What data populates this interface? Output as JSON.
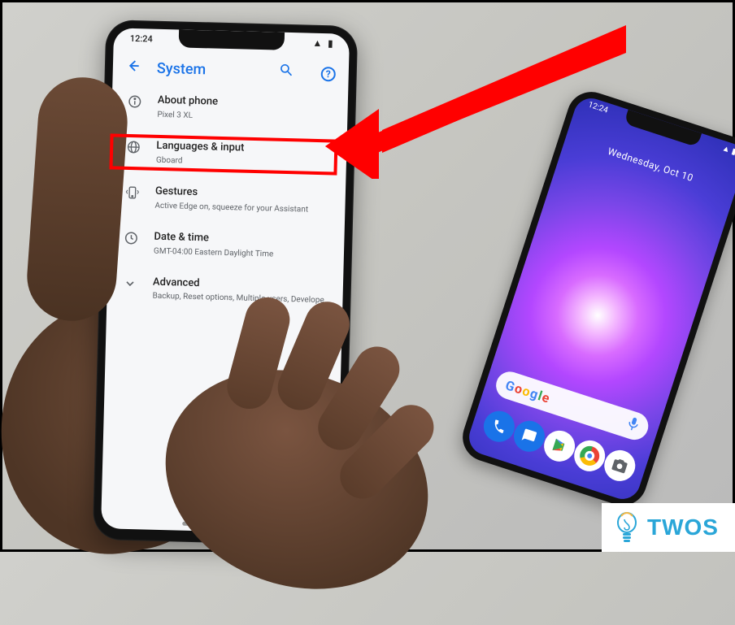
{
  "statusbar": {
    "time": "12:24"
  },
  "appbar": {
    "title": "System",
    "search_aria": "Search settings",
    "help_aria": "Help"
  },
  "items": {
    "about": {
      "label": "About phone",
      "secondary": "Pixel 3 XL"
    },
    "lang": {
      "label": "Languages & input",
      "secondary": "Gboard"
    },
    "gestures": {
      "label": "Gestures",
      "secondary": "Active Edge on, squeeze for your Assistant"
    },
    "datetime": {
      "label": "Date & time",
      "secondary": "GMT-04:00 Eastern Daylight Time"
    },
    "advanced": {
      "label": "Advanced",
      "secondary": "Backup, Reset options, Multiple users, Developer o..."
    }
  },
  "phone2": {
    "statusbar_time": "12:24",
    "date": "Wednesday, Oct 10",
    "dock": {
      "phone": "Phone",
      "msg": "Messages",
      "play": "Play Store",
      "chrome": "Chrome",
      "camera": "Camera"
    }
  },
  "watermark": {
    "text": "TWOS"
  },
  "annotations": {
    "highlight_target": "Languages & input",
    "arrow_color": "#ff0000"
  }
}
